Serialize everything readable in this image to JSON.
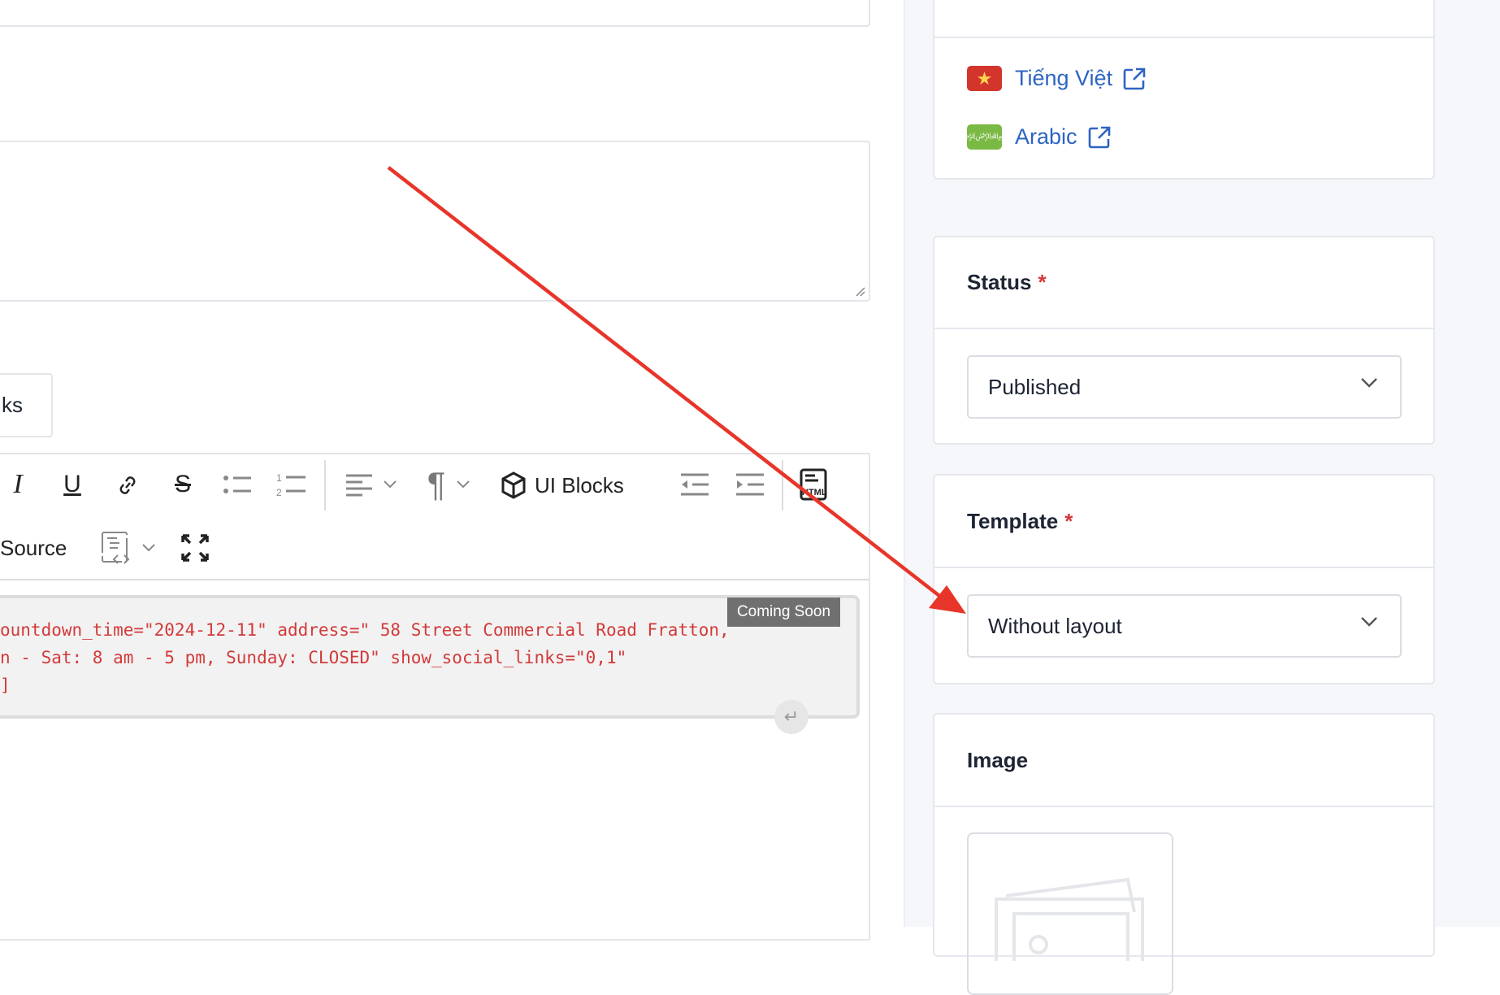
{
  "editor": {
    "partial_button_label": "ks",
    "toolbar": {
      "ui_blocks_label": "UI Blocks",
      "source_label": "Source"
    },
    "code_lines": [
      "ountdown_time=\"2024-12-11\" address=\" 58 Street Commercial Road Fratton,",
      "n - Sat: 8 am - 5 pm, Sunday: CLOSED\" show_social_links=\"0,1\"",
      "]"
    ],
    "badge": "Coming Soon"
  },
  "sidebar": {
    "languages": [
      {
        "label": "Tiếng Việt",
        "flag": "vietnam-flag",
        "color": "#d3352c"
      },
      {
        "label": "Arabic",
        "flag": "saudi-flag",
        "color": "#79b944"
      }
    ],
    "status": {
      "title": "Status",
      "required": "*",
      "value": "Published"
    },
    "template": {
      "title": "Template",
      "required": "*",
      "value": "Without layout"
    },
    "image": {
      "title": "Image"
    }
  },
  "colors": {
    "link": "#2c64c3",
    "required": "#d63939",
    "annotation_arrow": "#e8352a"
  }
}
